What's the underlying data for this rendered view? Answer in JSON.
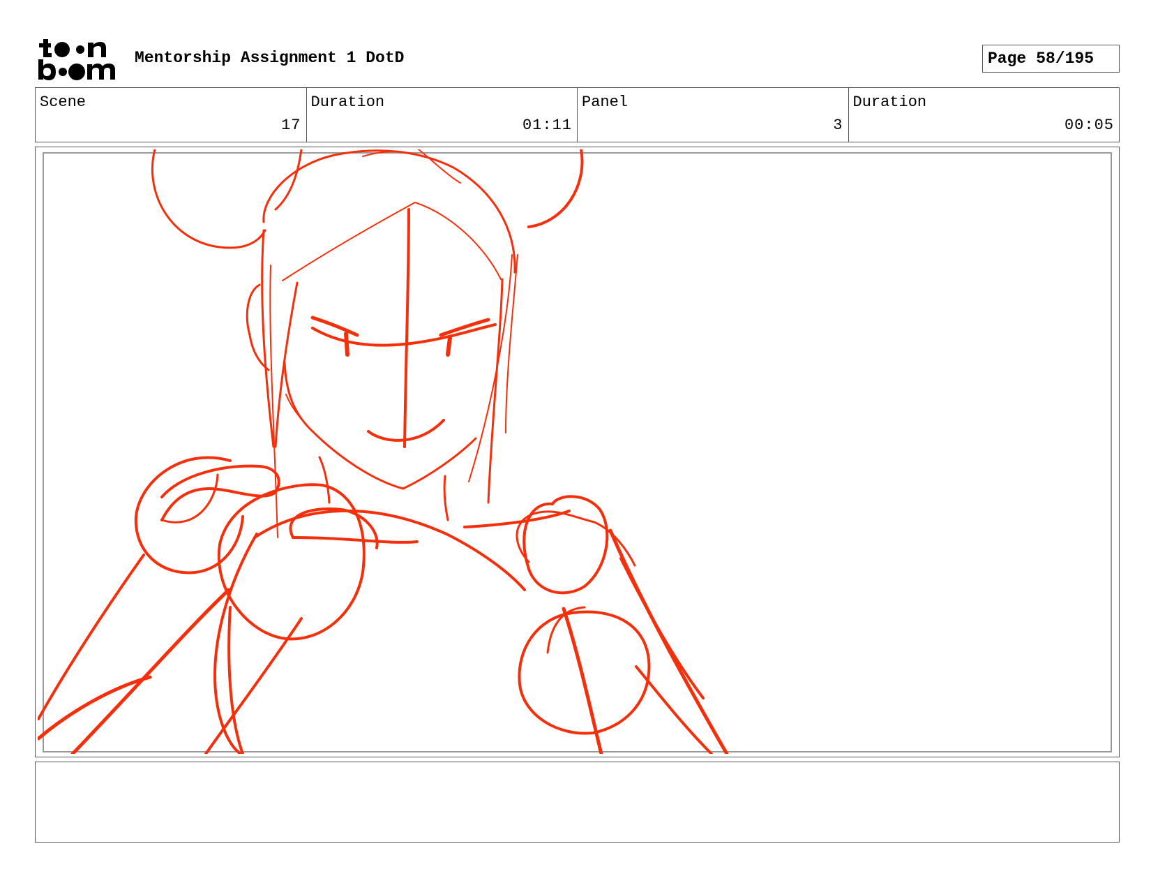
{
  "header": {
    "logo_name": "toon boom",
    "title": "Mentorship Assignment 1 DotD",
    "page_label": "Page",
    "page_number": "58/195"
  },
  "info": {
    "scene_label": "Scene",
    "scene_value": "17",
    "scene_duration_label": "Duration",
    "scene_duration_value": "01:11",
    "panel_label": "Panel",
    "panel_value": "3",
    "panel_duration_label": "Duration",
    "panel_duration_value": "00:05"
  },
  "sketch": {
    "stroke_color": "#f4300c"
  },
  "notes": {
    "text": ""
  }
}
